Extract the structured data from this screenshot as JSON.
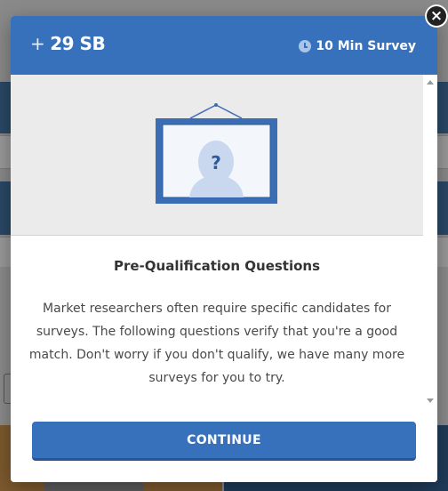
{
  "modal": {
    "reward_prefix": "+",
    "reward_value": "29 SB",
    "duration": "10 Min Survey",
    "title": "Pre-Qualification Questions",
    "body": "Market researchers often require specific candidates for surveys. The following questions verify that you're a good match. Don't worry if you don't qualify, we have many more surveys for you to try.",
    "continue_label": "CONTINUE",
    "close_glyph": "×",
    "question_glyph": "?"
  },
  "icons": {
    "close": "close-icon",
    "clock": "clock-icon",
    "frame": "picture-frame-icon"
  },
  "colors": {
    "primary": "#3770bb",
    "header": "#3770bb",
    "frame": "#3a6db4",
    "illustration_bg": "#ebebeb"
  }
}
